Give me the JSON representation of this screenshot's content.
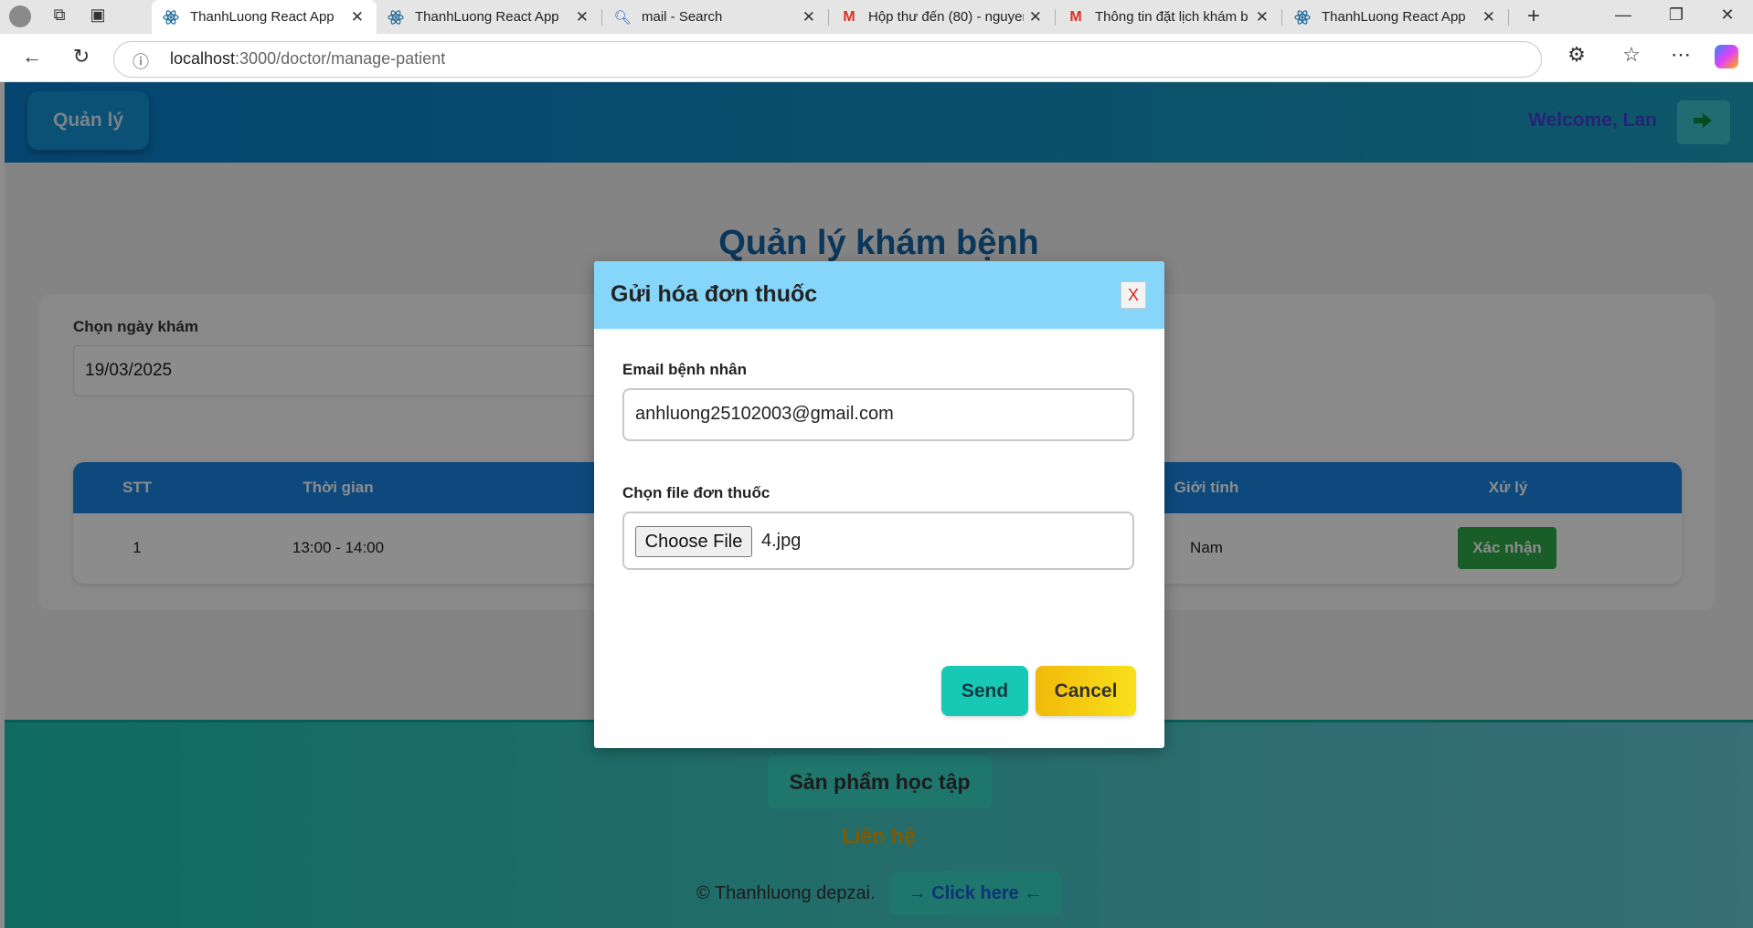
{
  "browser": {
    "tabs": [
      {
        "title": "ThanhLuong React App",
        "active": true,
        "icon": "react-icon"
      },
      {
        "title": "ThanhLuong React App",
        "active": false,
        "icon": "react-icon"
      },
      {
        "title": "mail - Search",
        "active": false,
        "icon": "search-icon"
      },
      {
        "title": "Hộp thư đến (80) - nguyen",
        "active": false,
        "icon": "gmail-icon"
      },
      {
        "title": "Thông tin đặt lịch khám b",
        "active": false,
        "icon": "gmail-icon"
      },
      {
        "title": "ThanhLuong React App",
        "active": false,
        "icon": "react-icon"
      }
    ],
    "url_host": "localhost",
    "url_path": ":3000/doctor/manage-patient"
  },
  "header": {
    "brand": "Quản lý",
    "welcome": "Welcome, Lan"
  },
  "main": {
    "title": "Quản lý khám bệnh",
    "date_label": "Chọn ngày khám",
    "date_value": "19/03/2025",
    "table": {
      "headers": [
        "STT",
        "Thời gian",
        "Giới tính",
        "Xử lý"
      ],
      "rows": [
        {
          "stt": "1",
          "time": "13:00 - 14:00",
          "gender": "Nam",
          "action": "Xác nhận"
        }
      ]
    }
  },
  "footer": {
    "product": "Sản phẩm học tập",
    "contact": "Liên hệ",
    "copyright": "© Thanhluong depzai.",
    "link": "→ Click here ←"
  },
  "modal": {
    "title": "Gửi hóa đơn thuốc",
    "close": "X",
    "email_label": "Email bệnh nhân",
    "email_value": "anhluong25102003@gmail.com",
    "file_label": "Chọn file đơn thuốc",
    "choose_file": "Choose File",
    "file_name": "4.jpg",
    "send": "Send",
    "cancel": "Cancel"
  }
}
